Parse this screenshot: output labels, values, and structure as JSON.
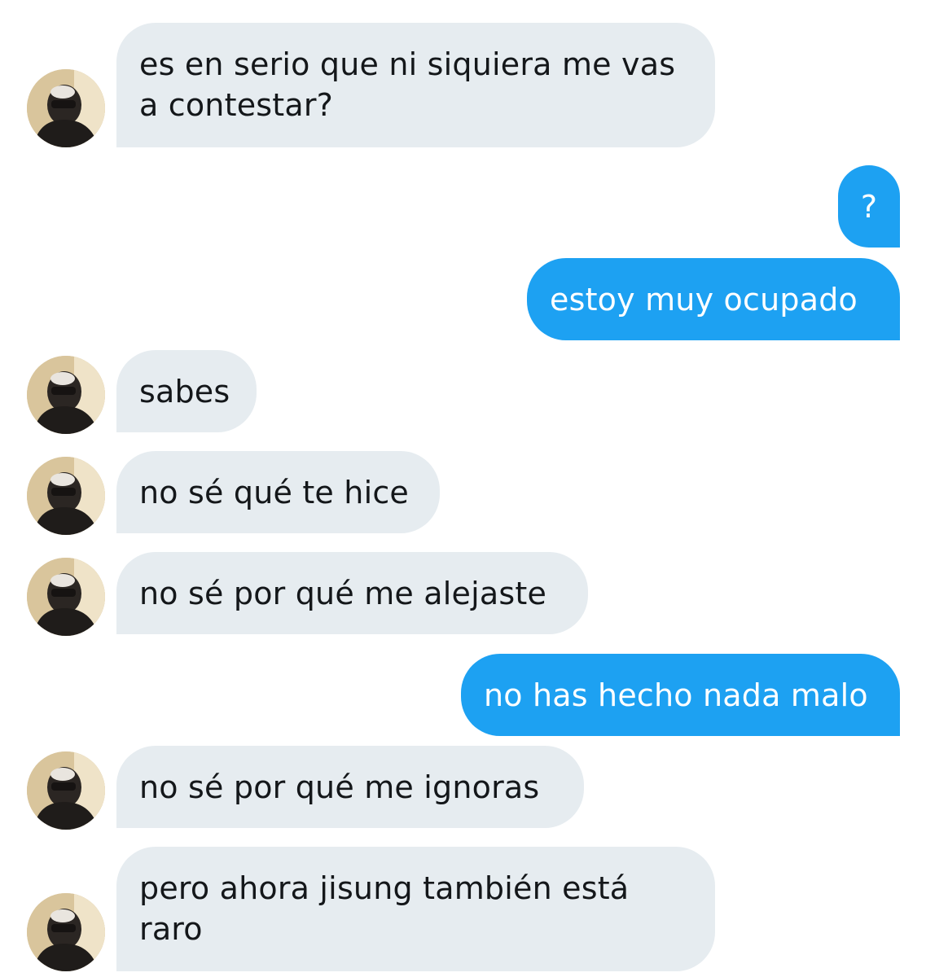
{
  "conversation": {
    "messages": [
      {
        "direction": "incoming",
        "lines": [
          "es en serio que ni siquiera me vas",
          "a contestar?"
        ],
        "avatar_icon": "profile-photo-icon"
      },
      {
        "direction": "outgoing",
        "lines": [
          "?"
        ]
      },
      {
        "direction": "outgoing",
        "lines": [
          "estoy muy ocupado"
        ]
      },
      {
        "direction": "incoming",
        "lines": [
          "sabes"
        ],
        "avatar_icon": "profile-photo-icon"
      },
      {
        "direction": "incoming",
        "lines": [
          "no sé qué te hice"
        ],
        "avatar_icon": "profile-photo-icon"
      },
      {
        "direction": "incoming",
        "lines": [
          "no sé por qué me alejaste"
        ],
        "avatar_icon": "profile-photo-icon"
      },
      {
        "direction": "outgoing",
        "lines": [
          "no has hecho nada malo"
        ]
      },
      {
        "direction": "incoming",
        "lines": [
          "no sé por qué me ignoras"
        ],
        "avatar_icon": "profile-photo-icon"
      },
      {
        "direction": "incoming",
        "lines": [
          "pero ahora jisung también está",
          "raro"
        ],
        "avatar_icon": "profile-photo-icon"
      }
    ]
  },
  "colors": {
    "incoming_bubble": "#e6ecf0",
    "incoming_text": "#14171a",
    "outgoing_bubble": "#1da1f2",
    "outgoing_text": "#ffffff"
  }
}
